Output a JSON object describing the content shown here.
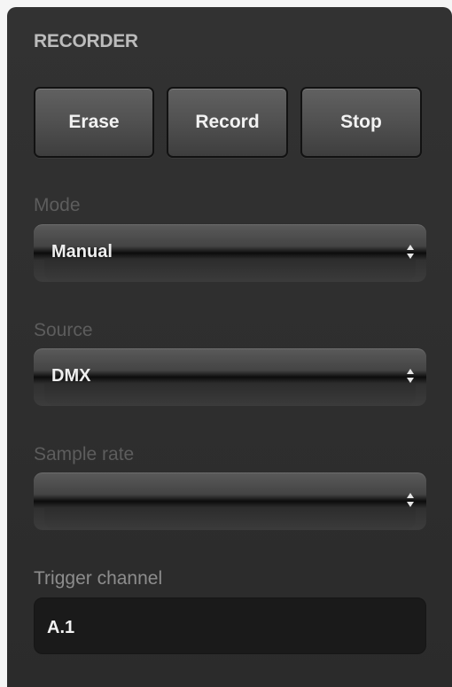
{
  "panel": {
    "title": "RECORDER"
  },
  "buttons": {
    "erase_label": "Erase",
    "record_label": "Record",
    "stop_label": "Stop"
  },
  "fields": {
    "mode": {
      "label": "Mode",
      "value": "Manual"
    },
    "source": {
      "label": "Source",
      "value": "DMX"
    },
    "sample_rate": {
      "label": "Sample rate",
      "value": ""
    },
    "trigger_channel": {
      "label": "Trigger channel",
      "value": "A.1"
    }
  },
  "icons": {
    "select_arrows": "up-down-chevron-icon"
  },
  "colors": {
    "panel_background": "#2e2e2e",
    "button_gradient_top": "#616161",
    "button_text": "#f2f2f2",
    "title_text": "#bcbcbc",
    "disabled_label": "#5d5d5d",
    "input_background": "#1a1a1a"
  }
}
